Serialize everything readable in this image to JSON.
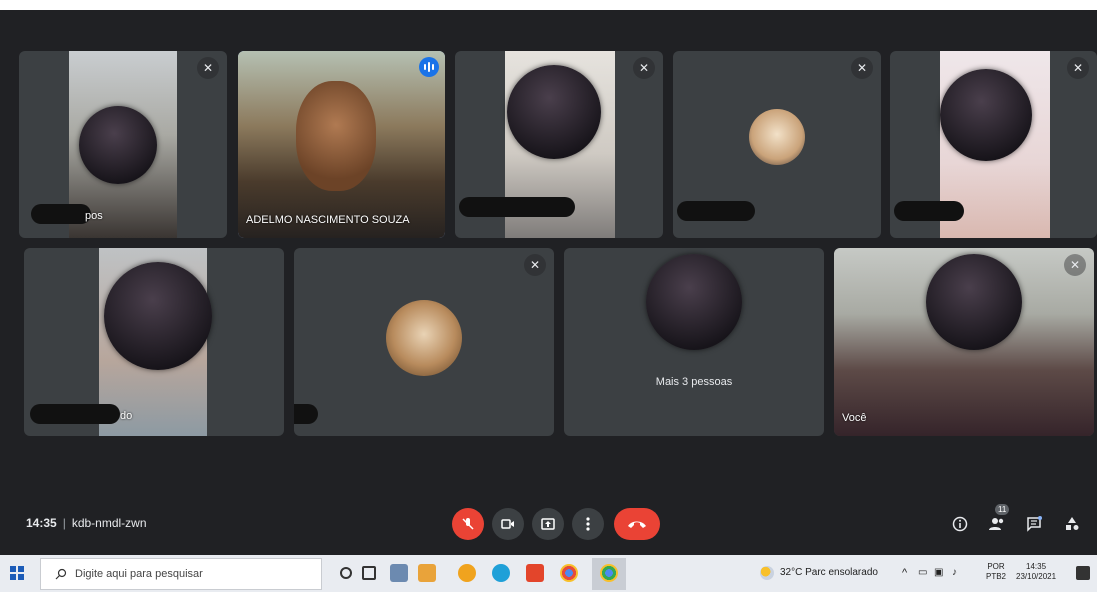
{
  "tiles_row1": [
    {
      "name_suffix": "pos",
      "muted": true
    },
    {
      "name": "ADELMO NASCIMENTO SOUZA",
      "speaking": true
    },
    {
      "name_suffix": "",
      "muted": true
    },
    {
      "name_suffix": "",
      "muted": true
    },
    {
      "name_suffix": "",
      "muted": true
    }
  ],
  "tiles_row2": [
    {
      "name_suffix": "do"
    },
    {
      "name_suffix": "",
      "muted": true
    },
    {
      "more_label": "Mais 3 pessoas"
    },
    {
      "name": "Você",
      "muted": true
    }
  ],
  "meeting": {
    "time": "14:35",
    "separator": "|",
    "code": "kdb-nmdl-zwn"
  },
  "controls": {
    "mic": "mic-off-icon",
    "camera": "camera-icon",
    "present": "present-icon",
    "more": "more-vert-icon",
    "end": "end-call-icon"
  },
  "right_icons": {
    "info": "info-icon",
    "people": "people-icon",
    "people_count": "11",
    "chat": "chat-icon",
    "activities": "activities-icon"
  },
  "taskbar": {
    "search_placeholder": "Digite aqui para pesquisar",
    "weather": "32°C  Parc ensolarado",
    "lang_top": "POR",
    "lang_bottom": "PTB2",
    "clock_time": "14:35",
    "clock_date": "23/10/2021"
  },
  "colors": {
    "bg": "#202124",
    "tile": "#3c4043",
    "accent": "#1a73e8",
    "danger": "#ea4335"
  }
}
